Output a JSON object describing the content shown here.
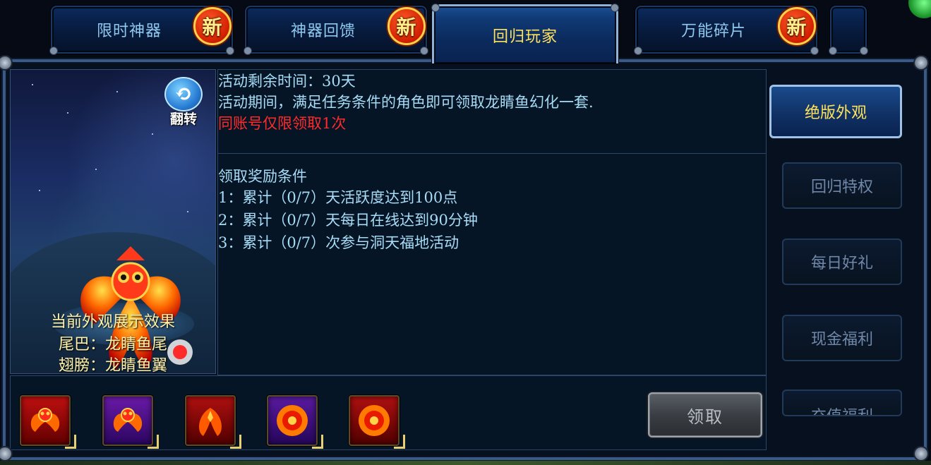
{
  "tabs": [
    {
      "label": "限时神器",
      "badge": "新"
    },
    {
      "label": "神器回馈",
      "badge": "新"
    },
    {
      "label": "回归玩家",
      "active": true
    },
    {
      "label": "万能碎片",
      "badge": "新"
    }
  ],
  "preview": {
    "flip_label": "翻转",
    "caption": "当前外观展示效果",
    "tail_line": "尾巴：龙睛鱼尾",
    "wing_line": "翅膀：龙睛鱼翼"
  },
  "info": {
    "remaining_time": "活动剩余时间：30天",
    "description": "活动期间，满足任务条件的角色即可领取龙睛鱼幻化一套.",
    "limit_notice": "同账号仅限领取1次"
  },
  "conditions": {
    "title": "领取奖励条件",
    "items": [
      "1：累计（0/7）天活跃度达到100点",
      "2：累计（0/7）天每日在线达到90分钟",
      "3：累计（0/7）次参与洞天福地活动"
    ]
  },
  "rewards": [
    {
      "icon": "fish-costume-red-icon"
    },
    {
      "icon": "fish-costume-purple-icon"
    },
    {
      "icon": "fish-tail-icon"
    },
    {
      "icon": "flame-orb-purple-icon"
    },
    {
      "icon": "flame-orb-red-icon"
    }
  ],
  "claim_button": "领取",
  "side_menu": [
    {
      "label": "绝版外观",
      "active": true
    },
    {
      "label": "回归特权"
    },
    {
      "label": "每日好礼"
    },
    {
      "label": "现金福利"
    },
    {
      "label": "充值福利"
    }
  ],
  "colors": {
    "active_text": "#ffe15a",
    "limit_text": "#ff2a2a",
    "body_text": "#a7dcf7"
  }
}
